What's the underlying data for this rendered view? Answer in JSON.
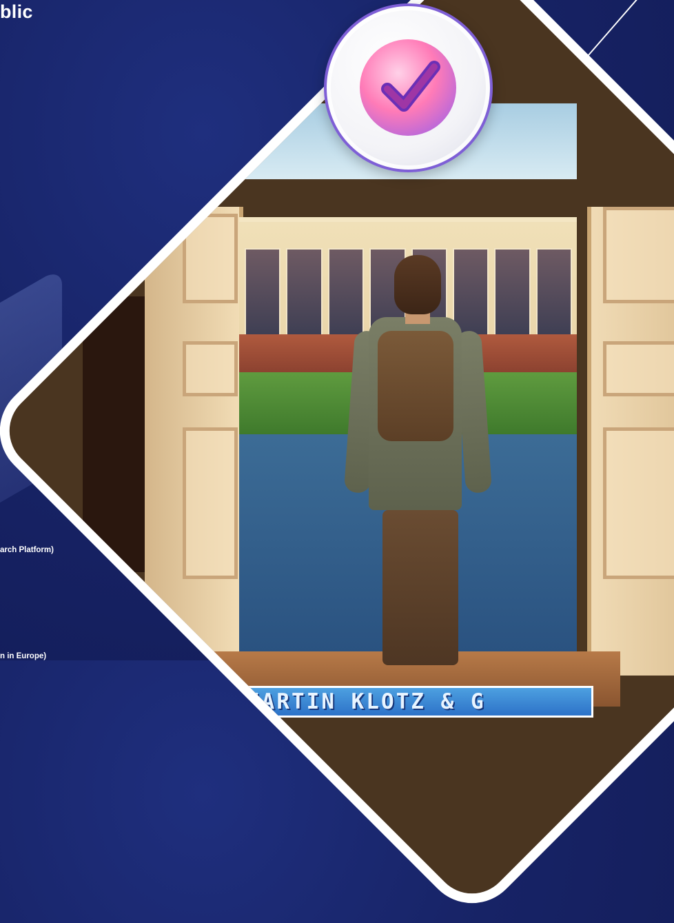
{
  "page": {
    "heading_fragment": "blic",
    "list_items": [
      "arch Platform)",
      "n in Europe)"
    ]
  },
  "hero": {
    "banner_text": "IARTIN KLOTZ & G",
    "badge_icon": "checkmark-icon"
  },
  "colors": {
    "background": "#172366",
    "frame": "#ffffff",
    "badge_gradient_start": "#ff5fa2",
    "badge_gradient_end": "#7b4fe3",
    "banner_bg": "#3b8ad8"
  }
}
